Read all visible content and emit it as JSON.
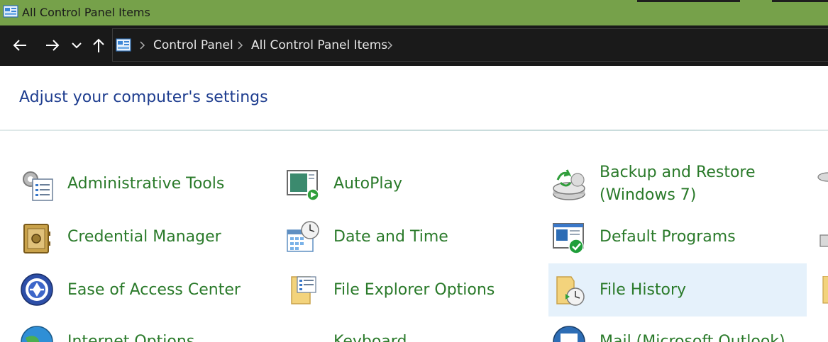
{
  "window": {
    "title": "All Control Panel Items"
  },
  "nav": {
    "back_icon": "arrow-left-icon",
    "forward_icon": "arrow-right-icon",
    "recent_icon": "chevron-down-icon",
    "up_icon": "arrow-up-icon"
  },
  "breadcrumb": {
    "items": [
      "Control Panel",
      "All Control Panel Items"
    ]
  },
  "page": {
    "heading": "Adjust your computer's settings"
  },
  "items": [
    {
      "label": "Administrative Tools",
      "icon": "administrative-tools-icon"
    },
    {
      "label": "AutoPlay",
      "icon": "autoplay-icon"
    },
    {
      "label": "Backup and Restore",
      "label2": "(Windows 7)",
      "icon": "backup-restore-icon"
    },
    {
      "label": "Credential Manager",
      "icon": "credential-manager-icon"
    },
    {
      "label": "Date and Time",
      "icon": "date-time-icon"
    },
    {
      "label": "Default Programs",
      "icon": "default-programs-icon"
    },
    {
      "label": "Ease of Access Center",
      "icon": "ease-of-access-icon"
    },
    {
      "label": "File Explorer Options",
      "icon": "file-explorer-options-icon"
    },
    {
      "label": "File History",
      "icon": "file-history-icon",
      "selected": true
    },
    {
      "label": "Internet Options",
      "icon": "internet-options-icon"
    },
    {
      "label": "Keyboard",
      "icon": "keyboard-icon"
    },
    {
      "label": "Mail (Microsoft Outlook)",
      "icon": "mail-icon"
    }
  ],
  "colors": {
    "titlebar": "#76a14a",
    "addressbar": "#191919",
    "heading": "#1e3d8f",
    "item_label": "#2a7a2a",
    "selection": "#e5f1fb"
  }
}
